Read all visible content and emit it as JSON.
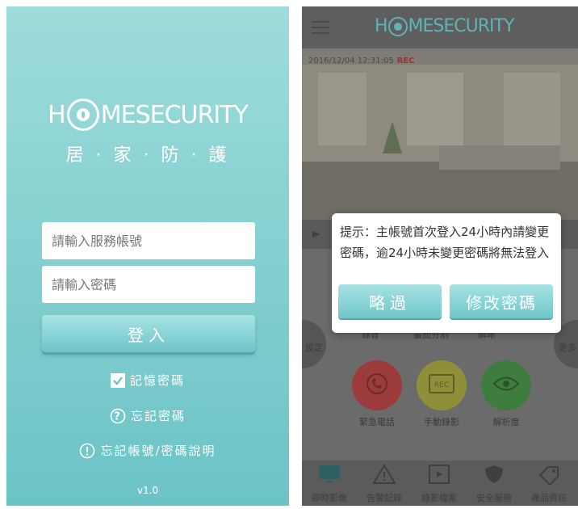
{
  "login": {
    "logo_parts": [
      "H",
      "MESECURITY"
    ],
    "slogan": "居 · 家 · 防 · 護",
    "account_placeholder": "請輸入服務帳號",
    "password_placeholder": "請輸入密碼",
    "login_label": "登入",
    "remember_label": "記憶密碼",
    "remember_checked": true,
    "forgot_label": "忘記密碼",
    "help_label": "忘記帳號/密碼說明",
    "version": "v1.0",
    "colors": {
      "background": "#8cd3d3",
      "button": "#6fc5c9"
    }
  },
  "app": {
    "logo_parts": [
      "H",
      "MESECURITY"
    ],
    "timestamp": "2016/12/04 12:31:05",
    "rec_label": "REC",
    "quick_labels": [
      "設定",
      "錄音",
      "畫面分割",
      "解晰",
      "更多"
    ],
    "functions": [
      {
        "label": "緊急電話",
        "icon": "phone-icon",
        "color": "#9c3b3b"
      },
      {
        "label": "手動錄影",
        "icon": "rec-icon",
        "color": "#8f8f3a"
      },
      {
        "label": "解析度",
        "icon": "eye-icon",
        "color": "#3f7d3f"
      }
    ],
    "tabs": [
      {
        "label": "即時影像",
        "icon": "monitor-icon"
      },
      {
        "label": "告警記錄",
        "icon": "warning-icon"
      },
      {
        "label": "錄影檔案",
        "icon": "film-icon"
      },
      {
        "label": "安全服務",
        "icon": "shield-icon"
      },
      {
        "label": "產品資訊",
        "icon": "tag-icon"
      }
    ],
    "dialog": {
      "message": "提示：主帳號首次登入24小時內請變更密碼，逾24小時未變更密碼將無法登入",
      "skip_label": "略過",
      "change_label": "修改密碼"
    }
  }
}
